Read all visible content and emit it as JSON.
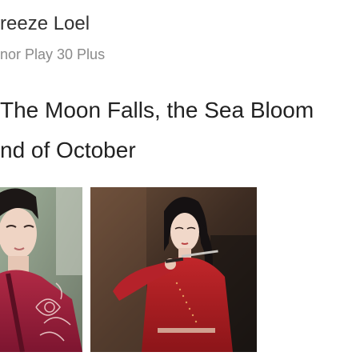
{
  "post": {
    "author_name": "reeze Loel",
    "author_subtitle": "nor Play 30 Plus",
    "text_line_1": "The Moon Falls, the Sea Bloom",
    "text_line_2": "nd of October"
  },
  "photos": [
    {
      "name": "photo-man-red-robe"
    },
    {
      "name": "photo-woman-red-dress"
    }
  ]
}
